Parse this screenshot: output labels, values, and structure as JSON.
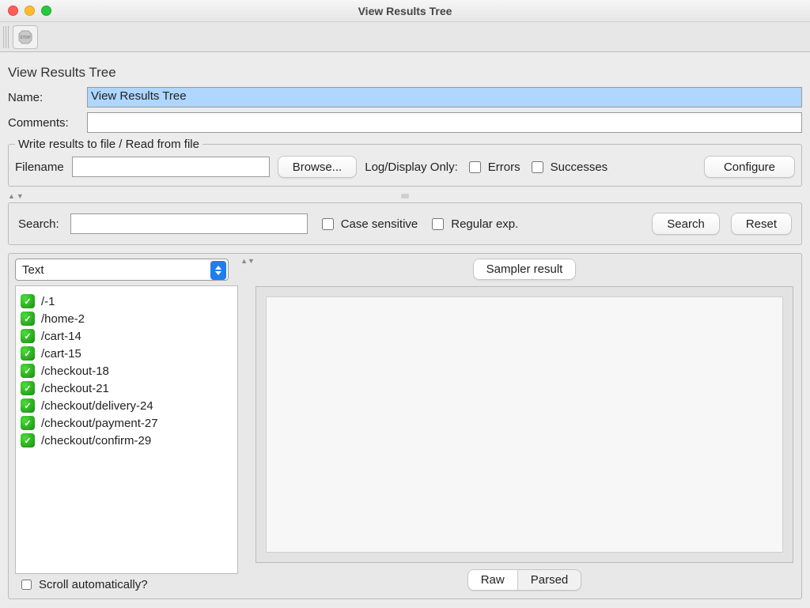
{
  "window": {
    "title": "View Results Tree"
  },
  "header": {
    "section_title": "View Results Tree"
  },
  "form": {
    "name_label": "Name:",
    "name_value": "View Results Tree",
    "comments_label": "Comments:",
    "comments_value": ""
  },
  "filebox": {
    "legend": "Write results to file / Read from file",
    "filename_label": "Filename",
    "filename_value": "",
    "browse_label": "Browse...",
    "logonly_label": "Log/Display Only:",
    "errors_label": "Errors",
    "successes_label": "Successes",
    "configure_label": "Configure"
  },
  "search": {
    "label": "Search:",
    "value": "",
    "case_label": "Case sensitive",
    "regex_label": "Regular exp.",
    "search_btn": "Search",
    "reset_btn": "Reset"
  },
  "renderer": {
    "selected": "Text"
  },
  "results": {
    "items": [
      "/-1",
      "/home-2",
      "/cart-14",
      "/cart-15",
      "/checkout-18",
      "/checkout-21",
      "/checkout/delivery-24",
      "/checkout/payment-27",
      "/checkout/confirm-29"
    ]
  },
  "scroll_label": "Scroll automatically?",
  "tabs": {
    "top": "Sampler result",
    "raw": "Raw",
    "parsed": "Parsed"
  }
}
